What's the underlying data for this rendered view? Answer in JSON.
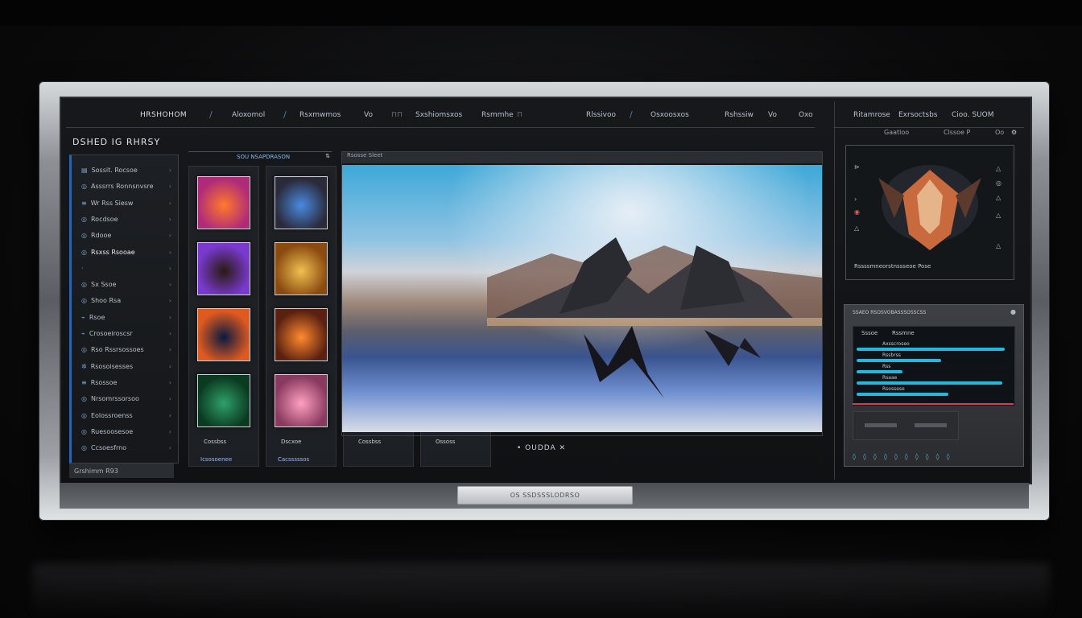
{
  "nav": {
    "brand": "HRSHOHOM",
    "items": [
      "Aloxomol",
      "Rsxmwmos",
      "Vo",
      "Sxshiomsxos",
      "Rsmmhe",
      "Rlssivoo",
      "Osxoosxos",
      "Rshssiw",
      "Vo",
      "Oxo"
    ],
    "right_items": [
      "Ritamrose",
      "Exrsoctsbs",
      "Cioo. SUOM"
    ],
    "right_sub": [
      "Gaatloo",
      "Clssoe P",
      "Oo"
    ]
  },
  "page_title": "DSHED  IG RHRSY",
  "sidebar": {
    "items": [
      {
        "icon": "▤",
        "label": "Sossit. Rocsoe"
      },
      {
        "icon": "◎",
        "label": "Asssrrs Ronnsnvsre"
      },
      {
        "icon": "≡",
        "label": "Wr Rss Siesw"
      },
      {
        "icon": "◎",
        "label": "Rocdsoe"
      },
      {
        "icon": "◎",
        "label": "Rdooe"
      },
      {
        "icon": "◎",
        "label": "Rsxss Rsooae"
      },
      {
        "icon": "·",
        "label": ""
      },
      {
        "icon": "◎",
        "label": "Sx Ssoe"
      },
      {
        "icon": "◎",
        "label": "Shoo Rsa"
      },
      {
        "icon": "⌁",
        "label": "Rsoe"
      },
      {
        "icon": "⌁",
        "label": "Crosoeiroscsr"
      },
      {
        "icon": "◎",
        "label": "Rso Rssrsossoes"
      },
      {
        "icon": "✲",
        "label": "Rsosoisesses"
      },
      {
        "icon": "≡",
        "label": "Rsossoe"
      },
      {
        "icon": "◎",
        "label": "Nrsomrssorsoo"
      },
      {
        "icon": "◎",
        "label": "Eolossroenss"
      },
      {
        "icon": "◎",
        "label": "Ruesoosesoe"
      },
      {
        "icon": "◎",
        "label": "Ccsoesfrno"
      }
    ],
    "footer": "Grshimm  R93"
  },
  "gallery": {
    "header": "SOU  NSAPDRASON",
    "header_right": "⇅",
    "labels": [
      "Cossbss",
      "Dscxoe",
      "Cossbss",
      "Ossoss"
    ],
    "bottom_labels": [
      "Icsosoenee",
      "Cacsssssos"
    ]
  },
  "preview": {
    "header": "Rsosse Sleet",
    "caption": "•  OUDDA  ✕"
  },
  "right_panel_1": {
    "bottom_label": "Rssssmneorstnssseoe Pose"
  },
  "right_panel_2": {
    "title": "SSAEO RSOSVOBASSSOSSCSS",
    "header_left": "Sssoe",
    "header_right": "Rssmne",
    "rows": [
      "Axsscroseo",
      "Rssbrss",
      "Rss",
      "Rsaae",
      "Rsossese"
    ],
    "values": [
      0.97,
      0.55,
      0.3,
      0.95,
      0.6
    ]
  },
  "chin": {
    "label": "OS SSDSSSLODRSO"
  },
  "colors": {
    "accent": "#23b8dd",
    "sidebar_accent": "#2e63a8",
    "alert": "#d0414e"
  }
}
